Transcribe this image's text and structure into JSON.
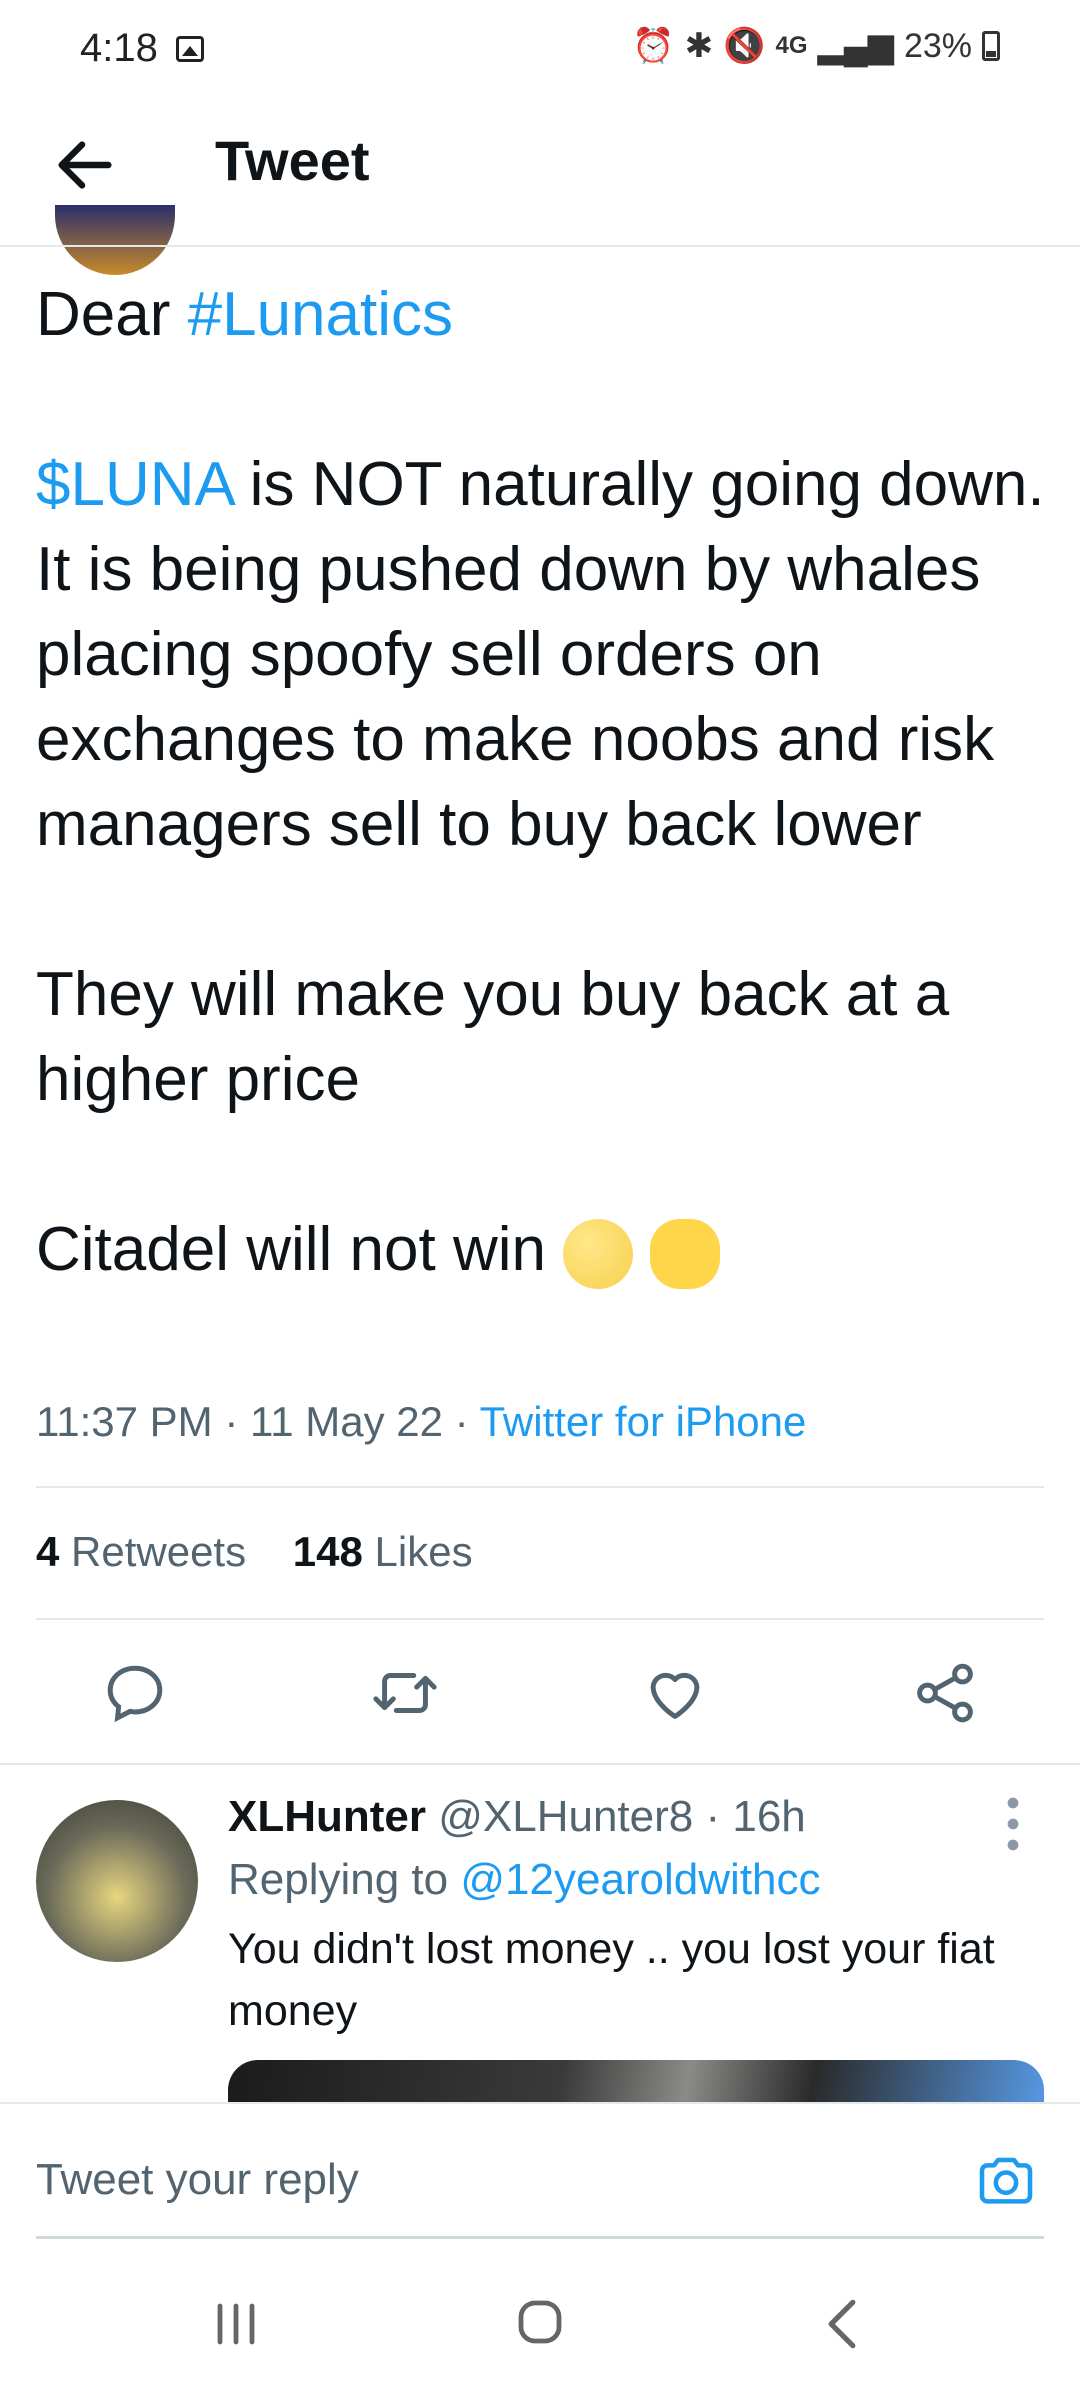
{
  "status_bar": {
    "time": "4:18",
    "network": "4G",
    "battery": "23%"
  },
  "header": {
    "title": "Tweet"
  },
  "tweet": {
    "line1_prefix": "Dear ",
    "hashtag": "#Lunatics",
    "cashtag": "$LUNA",
    "paragraph2": " is NOT naturally going down. It is being pushed down by whales placing spoofy sell orders on exchanges to make noobs and risk managers sell to buy back lower",
    "paragraph3": "They will make you buy back at a higher price",
    "paragraph4": "Citadel will not win",
    "time": "11:37 PM",
    "dot": " · ",
    "date": "11 May 22",
    "source": "Twitter for iPhone",
    "retweets_count": "4",
    "retweets_label": " Retweets",
    "likes_count": "148",
    "likes_label": " Likes"
  },
  "reply": {
    "name": "XLHunter",
    "handle": " @XLHunter8 · 16h",
    "replying_prefix": "Replying to ",
    "replying_to": "@12yearoldwithcc",
    "text": "You didn't lost money .. you lost your fiat money"
  },
  "composer": {
    "placeholder": "Tweet your reply"
  },
  "colors": {
    "accent": "#1d9bf0",
    "text": "#0f1419",
    "secondary": "#536471"
  }
}
